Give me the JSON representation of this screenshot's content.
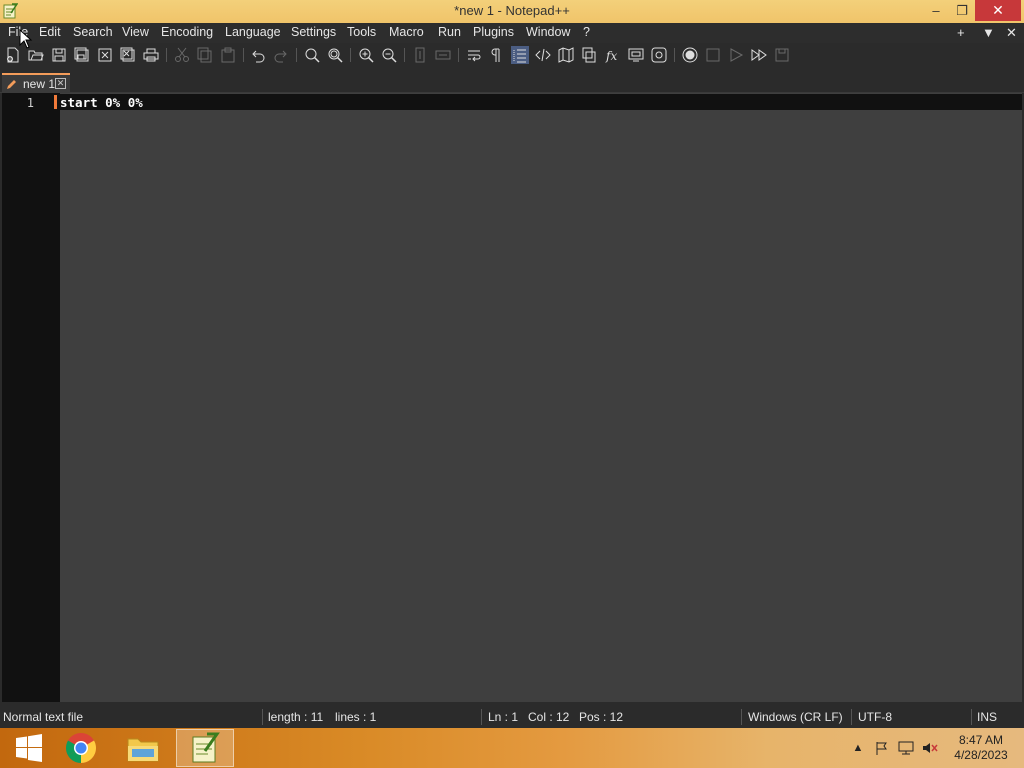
{
  "window": {
    "title": "*new 1 - Notepad++",
    "minimize_glyph": "–",
    "maximize_glyph": "❐",
    "close_glyph": "✕"
  },
  "menu": {
    "items": [
      "File",
      "Edit",
      "Search",
      "View",
      "Encoding",
      "Language",
      "Settings",
      "Tools",
      "Macro",
      "Run",
      "Plugins",
      "Window",
      "?"
    ],
    "right": [
      "+",
      "▼",
      "✕"
    ]
  },
  "toolbar": {
    "icons": [
      "new-file-icon",
      "open-file-icon",
      "save-icon",
      "save-all-icon",
      "close-icon",
      "close-all-icon",
      "print-icon",
      "cut-icon",
      "copy-icon",
      "paste-icon",
      "undo-icon",
      "redo-icon",
      "find-icon",
      "replace-icon",
      "zoom-in-icon",
      "zoom-out-icon",
      "sync-vertical-icon",
      "sync-horizontal-icon",
      "word-wrap-icon",
      "show-all-chars-icon",
      "indent-guide-icon",
      "language-tag-icon",
      "document-map-icon",
      "document-list-icon",
      "function-list-icon",
      "folder-as-workspace-icon",
      "monitoring-icon",
      "record-macro-icon",
      "stop-macro-icon",
      "play-macro-icon",
      "run-macro-multiple-icon",
      "save-macro-icon"
    ]
  },
  "tabs": [
    {
      "label": "new 1",
      "close": "✕"
    }
  ],
  "editor": {
    "lines": [
      {
        "number": "1",
        "text": "start 0% 0%"
      }
    ]
  },
  "statusbar": {
    "file_type": "Normal text file",
    "length": "length : 11",
    "lines": "lines : 1",
    "ln": "Ln : 1",
    "col": "Col : 12",
    "pos": "Pos : 12",
    "eol": "Windows (CR LF)",
    "encoding": "UTF-8",
    "mode": "INS"
  },
  "taskbar": {
    "apps": [
      "windows-start",
      "chrome",
      "file-explorer",
      "notepad-plus-plus"
    ],
    "tray_expand": "▲",
    "time": "8:47 AM",
    "date": "4/28/2023"
  },
  "colors": {
    "titlebar": "#f0c46a",
    "editor_bg": "#3f3f3f",
    "gutter_bg": "#111111",
    "accent_tab": "#f39c5a",
    "close_button": "#c7383a"
  }
}
